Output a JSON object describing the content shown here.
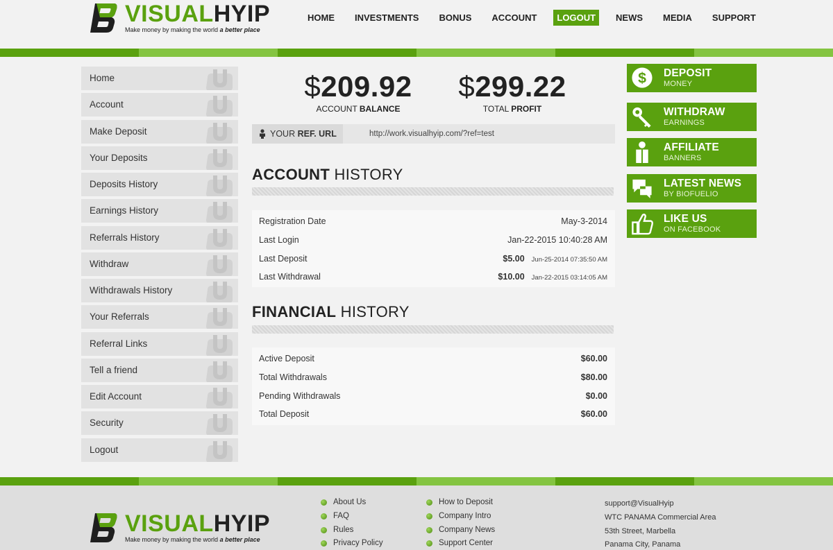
{
  "brand": {
    "name_green": "VISUAL",
    "name_dark": "HYIP",
    "tagline_plain": "Make money by making the world ",
    "tagline_emphasis": "a better place",
    "mark_letter": "B"
  },
  "nav": [
    {
      "label": "HOME",
      "active": false
    },
    {
      "label": "INVESTMENTS",
      "active": false
    },
    {
      "label": "BONUS",
      "active": false
    },
    {
      "label": "ACCOUNT",
      "active": false
    },
    {
      "label": "LOGOUT",
      "active": true
    },
    {
      "label": "NEWS",
      "active": false
    },
    {
      "label": "MEDIA",
      "active": false
    },
    {
      "label": "SUPPORT",
      "active": false
    }
  ],
  "sidebar": [
    "Home",
    "Account",
    "Make Deposit",
    "Your Deposits",
    "Deposits History",
    "Earnings History",
    "Referrals History",
    "Withdraw",
    "Withdrawals History",
    "Your Referrals",
    "Referral Links",
    "Tell a friend",
    "Edit Account",
    "Security",
    "Logout"
  ],
  "balances": {
    "balance": {
      "currency": "$",
      "amount": "209.92",
      "caption_plain": "ACCOUNT ",
      "caption_bold": "BALANCE"
    },
    "profit": {
      "currency": "$",
      "amount": "299.22",
      "caption_plain": "TOTAL ",
      "caption_bold": "PROFIT"
    }
  },
  "ref": {
    "label_plain": "YOUR ",
    "label_bold": "REF. URL",
    "url": "http://work.visualhyip.com/?ref=test"
  },
  "account_history": {
    "title_bold": "ACCOUNT",
    "title_plain": " HISTORY",
    "rows": [
      {
        "key": "Registration Date",
        "value": "May-3-2014",
        "date": ""
      },
      {
        "key": "Last Login",
        "value": "Jan-22-2015 10:40:28 AM",
        "date": ""
      },
      {
        "key": "Last Deposit",
        "value": "$5.00",
        "date": "Jun-25-2014 07:35:50 AM"
      },
      {
        "key": "Last Withdrawal",
        "value": "$10.00",
        "date": "Jan-22-2015 03:14:05 AM"
      }
    ]
  },
  "financial_history": {
    "title_bold": "FINANCIAL",
    "title_plain": " HISTORY",
    "rows": [
      {
        "key": "Active Deposit",
        "value": "$60.00"
      },
      {
        "key": "Total Withdrawals",
        "value": "$80.00"
      },
      {
        "key": "Pending Withdrawals",
        "value": "$0.00"
      },
      {
        "key": "Total Deposit",
        "value": "$60.00"
      }
    ]
  },
  "right_buttons": [
    {
      "title": "DEPOSIT",
      "sub": "MONEY",
      "icon": "dollar-icon"
    },
    {
      "title": "WITHDRAW",
      "sub": "EARNINGS",
      "icon": "key-icon"
    },
    {
      "title": "AFFILIATE",
      "sub": "BANNERS",
      "icon": "person-icon"
    },
    {
      "title": "LATEST NEWS",
      "sub": "BY BIOFUELIO",
      "icon": "chat-icon"
    },
    {
      "title": "LIKE US",
      "sub": "ON FACEBOOK",
      "icon": "thumbs-up-icon"
    }
  ],
  "footer": {
    "col1": [
      "About Us",
      "FAQ",
      "Rules",
      "Privacy Policy"
    ],
    "col2": [
      "How to Deposit",
      "Company Intro",
      "Company News",
      "Support Center"
    ],
    "contact": [
      "support@VisualHyip",
      "WTC PANAMA Commercial Area",
      "53th Street, Marbella",
      "Panama City, Panama"
    ]
  },
  "colors": {
    "accent": "#5aa10f",
    "accent_light": "#84c441",
    "sidebar_bg": "#e2e2e2",
    "footer_bg": "#dedede"
  }
}
